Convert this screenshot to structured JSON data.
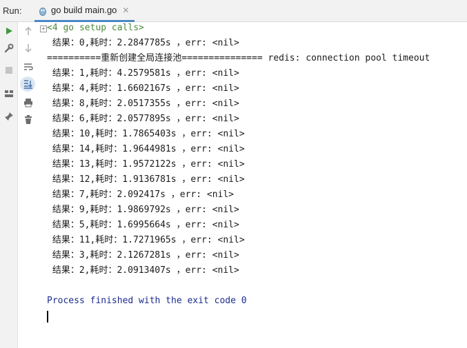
{
  "run_bar": {
    "label": "Run:",
    "tab_label": "go build main.go",
    "close_glyph": "✕"
  },
  "console": {
    "fold_glyph": "⊞",
    "setup_line": "<4 go setup calls>",
    "lines": [
      " 结果：0,耗时：2.2847785s ，err: <nil>",
      "==========重新创建全局连接池=============== redis: connection pool timeout",
      " 结果：1,耗时：4.2579581s ，err: <nil>",
      " 结果：4,耗时：1.6602167s ，err: <nil>",
      " 结果：8,耗时：2.0517355s ，err: <nil>",
      " 结果：6,耗时：2.0577895s ，err: <nil>",
      " 结果：10,耗时：1.7865403s ，err: <nil>",
      " 结果：14,耗时：1.9644981s ，err: <nil>",
      " 结果：13,耗时：1.9572122s ，err: <nil>",
      " 结果：12,耗时：1.9136781s ，err: <nil>",
      " 结果：7,耗时：2.092417s ，err: <nil>",
      " 结果：9,耗时：1.9869792s ，err: <nil>",
      " 结果：5,耗时：1.6995664s ，err: <nil>",
      " 结果：11,耗时：1.7271965s ，err: <nil>",
      " 结果：3,耗时：2.1267281s ，err: <nil>",
      " 结果：2,耗时：2.0913407s ，err: <nil>"
    ],
    "finished_line": "Process finished with the exit code 0"
  },
  "toolbar": {
    "left": [
      "run-icon",
      "wrench-icon",
      "stop-icon",
      "layout-icon",
      "pin-icon"
    ],
    "right": [
      "up-arrow-icon",
      "down-arrow-icon",
      "soft-wrap-icon",
      "scroll-to-end-icon",
      "print-icon",
      "trash-icon"
    ]
  },
  "colors": {
    "accent": "#4a88c7",
    "run_green": "#3d9a3d",
    "setup_green": "#4b8a3a",
    "finished_blue": "#1b2b8e"
  }
}
